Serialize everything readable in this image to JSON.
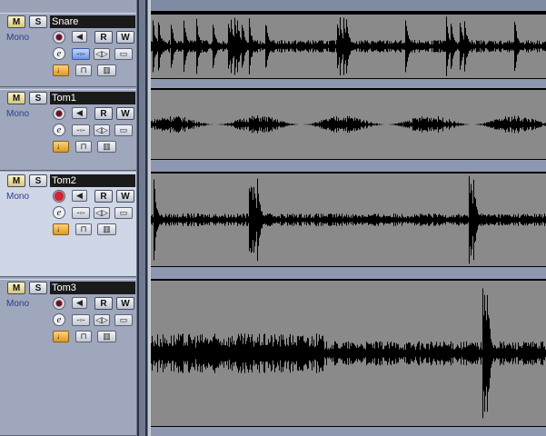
{
  "tracks": [
    {
      "name": "Snare",
      "mode": "Mono",
      "mute": "M",
      "solo": "S",
      "read": "R",
      "write": "W",
      "edit": "e",
      "monitor_on": false,
      "selected": false,
      "insert_active": true
    },
    {
      "name": "Tom1",
      "mode": "Mono",
      "mute": "M",
      "solo": "S",
      "read": "R",
      "write": "W",
      "edit": "e",
      "monitor_on": false,
      "selected": false,
      "insert_active": false
    },
    {
      "name": "Tom2",
      "mode": "Mono",
      "mute": "M",
      "solo": "S",
      "read": "R",
      "write": "W",
      "edit": "e",
      "monitor_on": true,
      "selected": true,
      "insert_active": false
    },
    {
      "name": "Tom3",
      "mode": "Mono",
      "mute": "M",
      "solo": "S",
      "read": "R",
      "write": "W",
      "edit": "e",
      "monitor_on": false,
      "selected": false,
      "insert_active": false
    }
  ],
  "icons": {
    "record": "record-enable-icon",
    "monitor": "speaker-monitor-icon",
    "insert": "insert-fx-icon",
    "eq": "eq-icon",
    "send": "send-icon",
    "lane": "note-lane-icon",
    "lock": "lock-icon",
    "folder": "folder-icon"
  },
  "colors": {
    "waveform": "#000000",
    "clip_bg": "#8a8a8a",
    "tracklist_bg": "#9aa3b8",
    "selected_bg": "#cfd6e6",
    "name_bg": "#1a1a1a"
  }
}
